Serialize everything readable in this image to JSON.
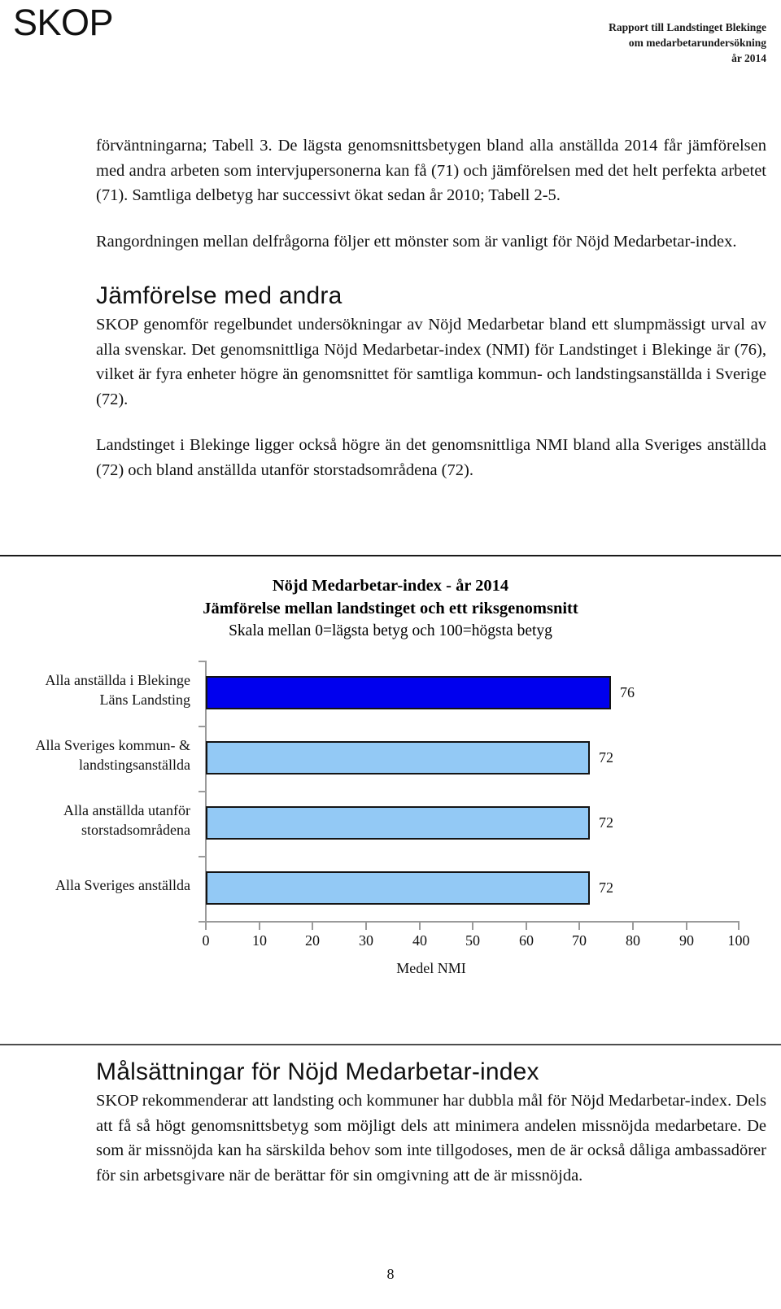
{
  "header": {
    "logo": "SKOP",
    "report_lines": [
      "Rapport till Landstinget Blekinge",
      "om medarbetarundersökning",
      "år 2014"
    ]
  },
  "body": {
    "paragraph_1": "förväntningarna; Tabell 3. De lägsta genomsnittsbetygen bland alla anställda 2014 får jämförelsen med andra arbeten som intervjupersonerna kan få (71) och jämförelsen med det helt perfekta arbetet (71). Samtliga delbetyg har successivt ökat sedan år 2010; Tabell 2-5.",
    "paragraph_2": "Rangordningen mellan delfrågorna följer ett mönster som är vanligt för Nöjd Medarbetar-index.",
    "heading_1": "Jämförelse med andra",
    "paragraph_3": "SKOP genomför regelbundet undersökningar av Nöjd Medarbetar bland ett slumpmässigt urval av alla svenskar. Det genomsnittliga Nöjd Medarbetar-index (NMI) för Landstinget i Blekinge är (76), vilket är fyra enheter högre än genomsnittet för samtliga kommun- och landstingsanställda i Sverige (72).",
    "paragraph_4": "Landstinget i Blekinge ligger också högre än det genomsnittliga NMI bland alla Sveriges anställda (72) och bland anställda utanför storstadsområdena (72).",
    "heading_2": "Målsättningar för Nöjd Medarbetar-index",
    "paragraph_5": "SKOP rekommenderar att landsting och kommuner har dubbla mål för Nöjd Medarbetar-index. Dels att få så högt genomsnittsbetyg som möjligt dels att minimera andelen missnöjda medarbetare. De som är missnöjda kan ha särskilda behov som inte tillgodoses, men de är också dåliga ambassadörer för sin arbetsgivare när de berättar för sin omgivning att de är missnöjda."
  },
  "chart_data": {
    "type": "bar",
    "orientation": "horizontal",
    "title": "Nöjd Medarbetar-index - år 2014",
    "subtitle": "Jämförelse mellan landstinget och ett riksgenomsnitt",
    "subtitle2": "Skala mellan 0=lägsta betyg och 100=högsta betyg",
    "xlabel": "Medel NMI",
    "ylabel": "",
    "xlim": [
      0,
      100
    ],
    "xticks": [
      0,
      10,
      20,
      30,
      40,
      50,
      60,
      70,
      80,
      90,
      100
    ],
    "grid": false,
    "legend": false,
    "categories": [
      "Alla anställda i Blekinge Läns Landsting",
      "Alla Sveriges kommun- & landstingsanställda",
      "Alla anställda utanför storstadsområdena",
      "Alla Sveriges anställda"
    ],
    "category_lines": [
      [
        "Alla anställda i Blekinge",
        "Läns Landsting"
      ],
      [
        "Alla Sveriges kommun- &",
        "landstingsanställda"
      ],
      [
        "Alla anställda utanför",
        "storstadsområdena"
      ],
      [
        "Alla Sveriges anställda"
      ]
    ],
    "values": [
      76,
      72,
      72,
      72
    ],
    "value_labels": [
      "76",
      "72",
      "72",
      "72"
    ],
    "colors": [
      "#0000ee",
      "#93c9f5",
      "#93c9f5",
      "#93c9f5"
    ],
    "bar_border_color": "#141414",
    "axis_color": "#9a9a9a"
  },
  "footer": {
    "page_number": "8"
  }
}
